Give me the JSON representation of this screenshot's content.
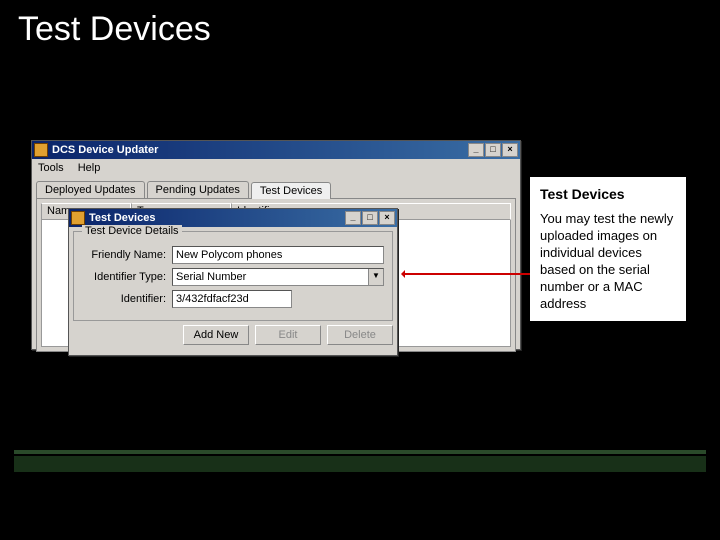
{
  "slide": {
    "title": "Test Devices"
  },
  "mainWindow": {
    "title": "DCS Device Updater",
    "menu": {
      "tools": "Tools",
      "help": "Help"
    },
    "tabs": {
      "deployed": "Deployed Updates",
      "pending": "Pending Updates",
      "test": "Test Devices"
    },
    "columns": {
      "name": "Name",
      "type": "Type",
      "identifier": "Identifier"
    }
  },
  "dialog": {
    "title": "Test Devices",
    "group_legend": "Test Device Details",
    "labels": {
      "friendlyName": "Friendly Name:",
      "identifierType": "Identifier Type:",
      "identifier": "Identifier:"
    },
    "values": {
      "friendlyName": "New Polycom phones",
      "identifierType": "Serial Number",
      "identifier": "3/432fdfacf23d"
    },
    "buttons": {
      "addNew": "Add New",
      "edit": "Edit",
      "delete": "Delete"
    }
  },
  "callout": {
    "title": "Test Devices",
    "body": "You may test the newly uploaded images on individual devices based on the serial number or a MAC address"
  },
  "winControls": {
    "min": "_",
    "max": "□",
    "close": "×"
  }
}
